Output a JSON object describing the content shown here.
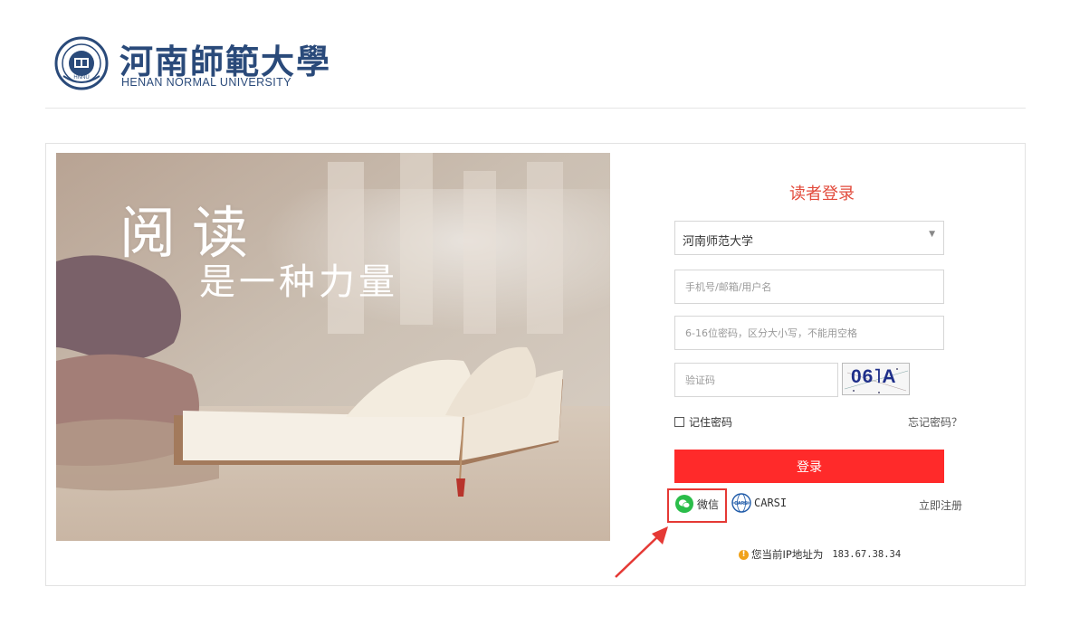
{
  "header": {
    "logo_cn": "河南師範大學",
    "logo_en": "HENAN NORMAL UNIVERSITY",
    "emblem_text": "HNNU"
  },
  "hero": {
    "title_line_1": "阅读",
    "title_line_2": "是一种力量"
  },
  "login": {
    "title": "读者登录",
    "org_select": {
      "value": "河南师范大学"
    },
    "username": {
      "value": "",
      "placeholder": "手机号/邮箱/用户名"
    },
    "password": {
      "value": "",
      "placeholder": "6-16位密码，区分大小写，不能用空格"
    },
    "captcha": {
      "value": "",
      "placeholder": "验证码",
      "image_text": "06˥A"
    },
    "remember_label": "记住密码",
    "remember_checked": false,
    "forgot_label": "忘记密码？",
    "submit_label": "登录",
    "wechat_label": "微信",
    "carsi_label": "CARSI",
    "carsi_icon_text": "CARSI",
    "register_label": "立即注册"
  },
  "ip_notice": {
    "label": "您当前IP地址为",
    "ip": "183.67.38.34"
  },
  "colors": {
    "accent_red": "#ff2a2a",
    "title_red": "#e24a3b",
    "wechat_green": "#2bbd4a",
    "annotation_red": "#e53935",
    "logo_blue": "#2a4a7a"
  },
  "icons": [
    "university-emblem-icon",
    "dropdown-arrow-icon",
    "wechat-icon",
    "carsi-icon",
    "info-icon",
    "annotation-arrow-icon"
  ]
}
